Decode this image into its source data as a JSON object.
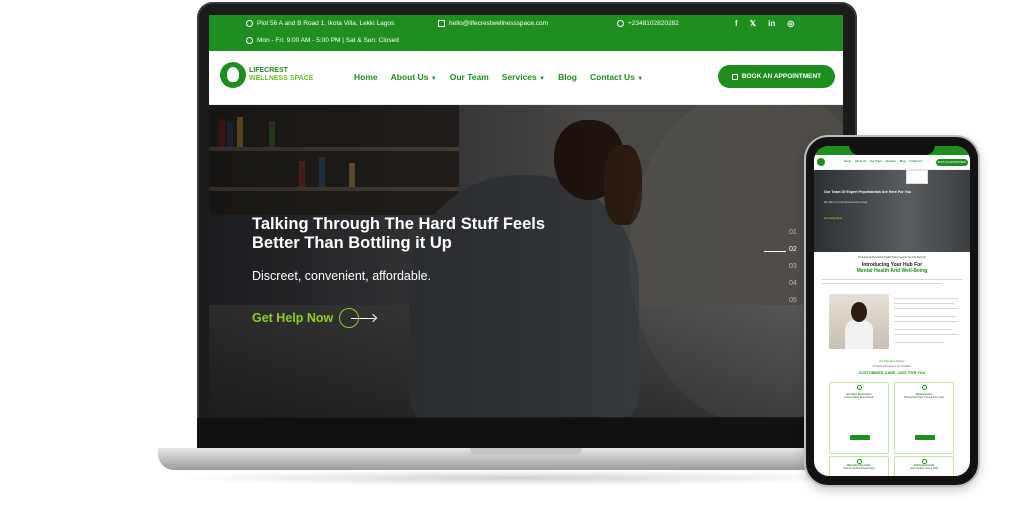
{
  "laptop": {
    "topbar": {
      "address": "Plot 56 A and B Road 1, Ikota Villa, Lekki Lagos",
      "email": "hello@lifecrestwellnessspace.com",
      "phone": "+2348102820282",
      "hours": "Mon - Fri: 9:00 AM - 5:00 PM | Sat & Sun: Closed",
      "social": [
        "f",
        "𝕏",
        "in",
        "◎"
      ]
    },
    "logo": {
      "line1": "LIFECREST",
      "line2": "WELLNESS SPACE"
    },
    "menu": {
      "home": "Home",
      "about": "About Us",
      "team": "Our Team",
      "services": "Services",
      "blog": "Blog",
      "contact": "Contact Us"
    },
    "cta": "BOOK AN APPOINTMENT",
    "hero": {
      "title": "Talking Through The Hard Stuff Feels Better Than Bottling it Up",
      "subtitle": "Discreet, convenient, affordable.",
      "button": "Get Help Now",
      "slides": [
        "01",
        "02",
        "03",
        "04",
        "05"
      ],
      "active_slide": "02"
    }
  },
  "phone": {
    "book": "BOOK AN APPOINTMENT",
    "links": [
      "Home",
      "About Us",
      "Our Team",
      "Services",
      "Blog",
      "Contact Us"
    ],
    "hero_title": "Our Team Of Expert Psychiatrists Are Here For You",
    "hero_sub": "We offer you both physical and virtual",
    "hero_button": "Get Help Now",
    "kicker": "Professional Psychiatric Health Care In Lagos You Can Rely On",
    "heading_line1": "Introducing Your Hub For",
    "heading_line2": "Mental Health And Well-Being",
    "services_kicker": "Our Signature Service",
    "services_sub": "Treatment Programs by Condition",
    "services_heading": "CUSTOMIZED CARE, JUST FOR YOU",
    "cards": [
      {
        "title": "Anxiety Disorders",
        "subtitle": "Calmer Minds, Better Moods"
      },
      {
        "title": "Depression",
        "subtitle": "Helping Find Hope Through Every Step"
      },
      {
        "title": "Bipolar Disorder",
        "subtitle": "Restore Healthy Relationships"
      },
      {
        "title": "Schizophrenia",
        "subtitle": "Learn Healthy Coping Skills"
      }
    ]
  }
}
